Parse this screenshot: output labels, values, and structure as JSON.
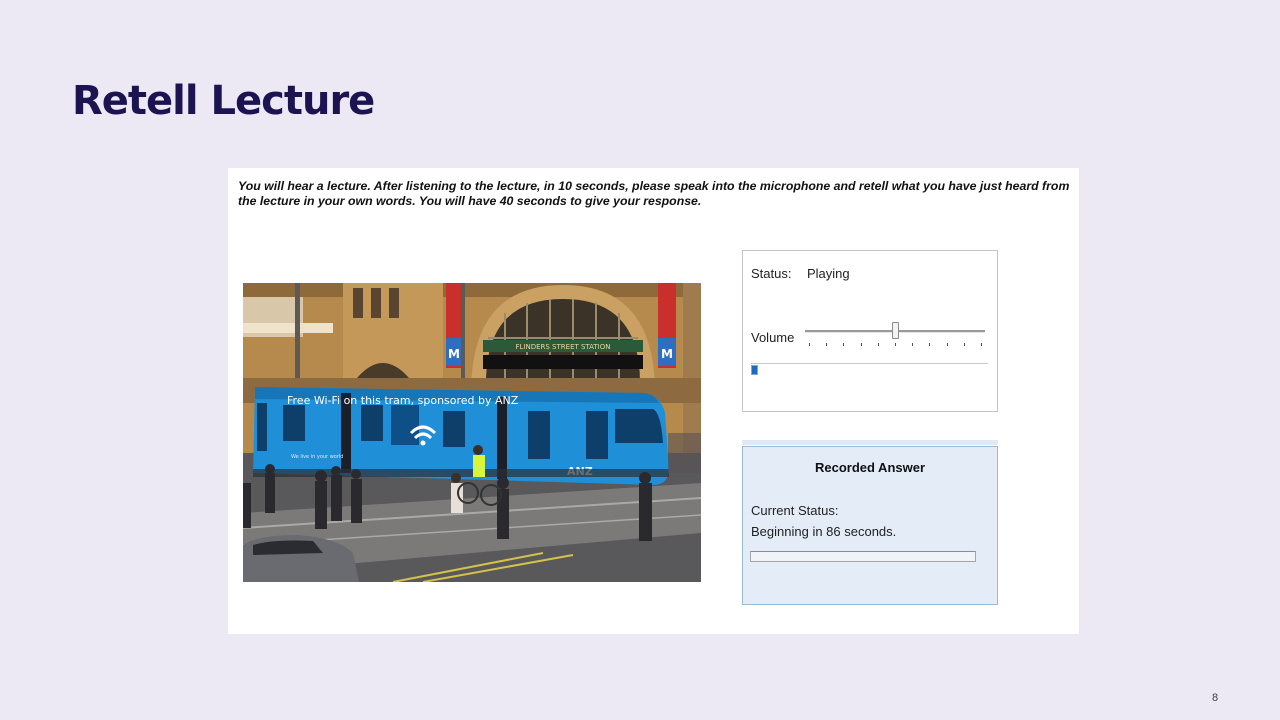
{
  "slide": {
    "title": "Retell Lecture",
    "page_number": "8"
  },
  "task": {
    "instructions": "You will hear a lecture. After listening to the lecture, in 10 seconds, please speak into the microphone and retell what you have just heard from the lecture in your own words. You will have 40 seconds to give your response."
  },
  "photo": {
    "tram_banner": "Free Wi-Fi on this tram, sponsored by ANZ",
    "tram_slogan": "We live in your world",
    "tram_brand": "ANZ",
    "station_sign": "FLINDERS STREET STATION",
    "metro_sign": "M"
  },
  "audio_player": {
    "status_label": "Status:",
    "status_value": "Playing",
    "volume_label": "Volume",
    "volume_level": 0.5,
    "volume_ticks": 11,
    "playback_progress": 0.02
  },
  "recorder": {
    "title": "Recorded Answer",
    "current_status_label": "Current Status:",
    "current_status_value": "Beginning in 86 seconds.",
    "progress": 0
  },
  "colors": {
    "slide_background": "#ece9f4",
    "title": "#1c1450",
    "tram": "#1f8fd8",
    "progress_fill": "#1a6cc2",
    "record_box_background": "#e3ecf7"
  }
}
